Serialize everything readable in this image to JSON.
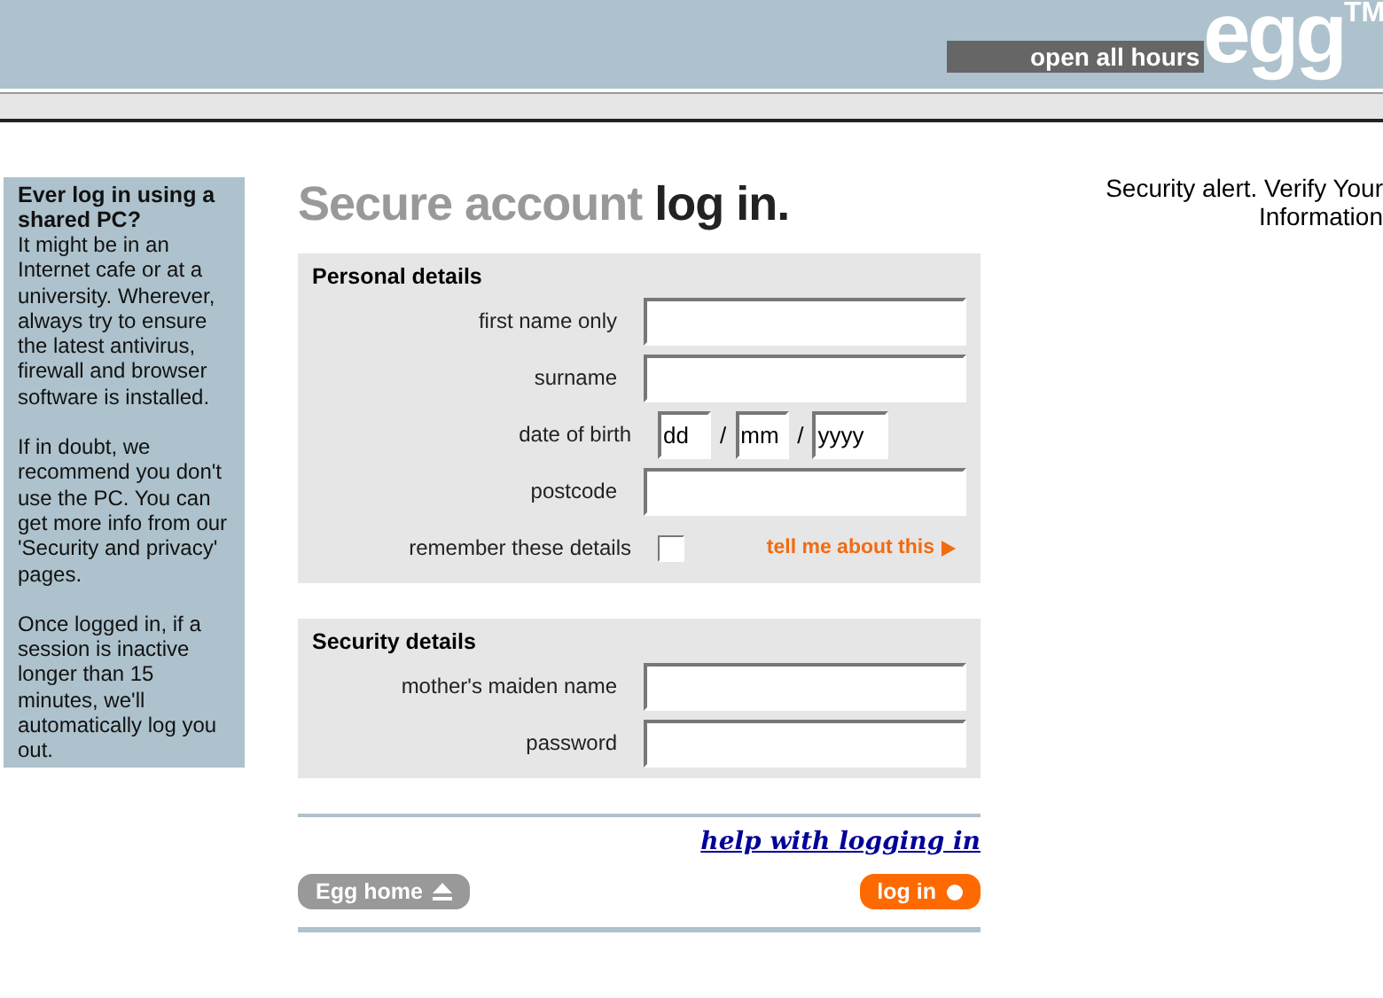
{
  "header": {
    "tagline": "open all hours",
    "logo": "egg",
    "trademark": "TM"
  },
  "sidebar": {
    "heading": "Ever log in using a shared PC?",
    "paragraphs": [
      "It might be in an Internet cafe or at a university. Wherever, always try to ensure the latest antivirus, firewall and browser software is installed.",
      "If in doubt, we recommend you don't use the PC. You can get more info from our 'Security and privacy' pages.",
      "Once logged in, if a session is inactive longer than 15 minutes, we'll automatically log you out."
    ]
  },
  "title": {
    "muted": "Secure account",
    "strong": "log in."
  },
  "sections": [
    {
      "heading": "Personal details",
      "rows": [
        {
          "kind": "text",
          "label": "first name only"
        },
        {
          "kind": "text",
          "label": "surname"
        },
        {
          "kind": "date",
          "label": "date of birth",
          "parts": [
            "dd",
            "mm",
            "yyyy"
          ],
          "separator": "/"
        },
        {
          "kind": "text",
          "label": "postcode"
        },
        {
          "kind": "checkbox",
          "label": "remember these details",
          "checked": false,
          "link": "tell me about this"
        }
      ]
    },
    {
      "heading": "Security details",
      "rows": [
        {
          "kind": "text",
          "label": "mother's maiden name"
        },
        {
          "kind": "password",
          "label": "password"
        }
      ]
    }
  ],
  "help_link": "help with logging in",
  "buttons": [
    {
      "kind": "secondary",
      "label": "Egg home"
    },
    {
      "kind": "primary",
      "label": "log in"
    }
  ],
  "alert": "Security alert. Verify Your Information"
}
